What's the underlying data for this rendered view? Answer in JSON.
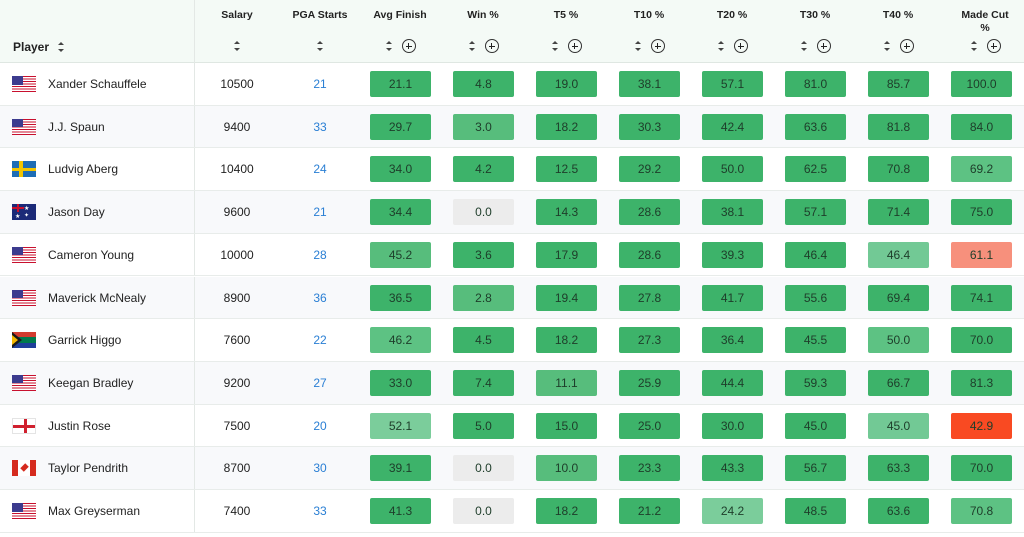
{
  "columns": {
    "player": "Player",
    "salary": "Salary",
    "pga_starts": "PGA Starts",
    "avg_finish": "Avg Finish",
    "win": "Win %",
    "t5": "T5 %",
    "t10": "T10 %",
    "t20": "T20 %",
    "t30": "T30 %",
    "t40": "T40 %",
    "made_cut": "Made Cut\n%"
  },
  "rows": [
    {
      "name": "Xander Schauffele",
      "flag": "us-flag-icon",
      "salary": "10500",
      "starts": "21",
      "avg_finish": "21.1",
      "win": "4.8",
      "t5": "19.0",
      "t10": "38.1",
      "t20": "57.1",
      "t30": "81.0",
      "t40": "85.7",
      "made_cut": "100.0"
    },
    {
      "name": "J.J. Spaun",
      "flag": "us-flag-icon",
      "salary": "9400",
      "starts": "33",
      "avg_finish": "29.7",
      "win": "3.0",
      "t5": "18.2",
      "t10": "30.3",
      "t20": "42.4",
      "t30": "63.6",
      "t40": "81.8",
      "made_cut": "84.0"
    },
    {
      "name": "Ludvig Aberg",
      "flag": "sweden-flag-icon",
      "salary": "10400",
      "starts": "24",
      "avg_finish": "34.0",
      "win": "4.2",
      "t5": "12.5",
      "t10": "29.2",
      "t20": "50.0",
      "t30": "62.5",
      "t40": "70.8",
      "made_cut": "69.2"
    },
    {
      "name": "Jason Day",
      "flag": "australia-flag-icon",
      "salary": "9600",
      "starts": "21",
      "avg_finish": "34.4",
      "win": "0.0",
      "t5": "14.3",
      "t10": "28.6",
      "t20": "38.1",
      "t30": "57.1",
      "t40": "71.4",
      "made_cut": "75.0"
    },
    {
      "name": "Cameron Young",
      "flag": "us-flag-icon",
      "salary": "10000",
      "starts": "28",
      "avg_finish": "45.2",
      "win": "3.6",
      "t5": "17.9",
      "t10": "28.6",
      "t20": "39.3",
      "t30": "46.4",
      "t40": "46.4",
      "made_cut": "61.1"
    },
    {
      "name": "Maverick McNealy",
      "flag": "us-flag-icon",
      "salary": "8900",
      "starts": "36",
      "avg_finish": "36.5",
      "win": "2.8",
      "t5": "19.4",
      "t10": "27.8",
      "t20": "41.7",
      "t30": "55.6",
      "t40": "69.4",
      "made_cut": "74.1"
    },
    {
      "name": "Garrick Higgo",
      "flag": "south-africa-flag-icon",
      "salary": "7600",
      "starts": "22",
      "avg_finish": "46.2",
      "win": "4.5",
      "t5": "18.2",
      "t10": "27.3",
      "t20": "36.4",
      "t30": "45.5",
      "t40": "50.0",
      "made_cut": "70.0"
    },
    {
      "name": "Keegan Bradley",
      "flag": "us-flag-icon",
      "salary": "9200",
      "starts": "27",
      "avg_finish": "33.0",
      "win": "7.4",
      "t5": "11.1",
      "t10": "25.9",
      "t20": "44.4",
      "t30": "59.3",
      "t40": "66.7",
      "made_cut": "81.3"
    },
    {
      "name": "Justin Rose",
      "flag": "england-flag-icon",
      "salary": "7500",
      "starts": "20",
      "avg_finish": "52.1",
      "win": "5.0",
      "t5": "15.0",
      "t10": "25.0",
      "t20": "30.0",
      "t30": "45.0",
      "t40": "45.0",
      "made_cut": "42.9"
    },
    {
      "name": "Taylor Pendrith",
      "flag": "canada-flag-icon",
      "salary": "8700",
      "starts": "30",
      "avg_finish": "39.1",
      "win": "0.0",
      "t5": "10.0",
      "t10": "23.3",
      "t20": "43.3",
      "t30": "56.7",
      "t40": "63.3",
      "made_cut": "70.0"
    },
    {
      "name": "Max Greyserman",
      "flag": "us-flag-icon",
      "salary": "7400",
      "starts": "33",
      "avg_finish": "41.3",
      "win": "0.0",
      "t5": "18.2",
      "t10": "21.2",
      "t20": "24.2",
      "t30": "48.5",
      "t40": "63.6",
      "made_cut": "70.8"
    }
  ],
  "cell_colors": [
    {
      "avg_finish": "#3db36a",
      "win": "#3db36a",
      "t5": "#3db36a",
      "t10": "#3db36a",
      "t20": "#3db36a",
      "t30": "#3db36a",
      "t40": "#3db36a",
      "made_cut": "#3db36a"
    },
    {
      "avg_finish": "#3db36a",
      "win": "#57bd7c",
      "t5": "#3db36a",
      "t10": "#3db36a",
      "t20": "#3db36a",
      "t30": "#3db36a",
      "t40": "#3db36a",
      "made_cut": "#3db36a"
    },
    {
      "avg_finish": "#3db36a",
      "win": "#3db36a",
      "t5": "#3db36a",
      "t10": "#3db36a",
      "t20": "#3db36a",
      "t30": "#3db36a",
      "t40": "#3db36a",
      "made_cut": "#5dc283"
    },
    {
      "avg_finish": "#3db36a",
      "win": "#ececec",
      "t5": "#3db36a",
      "t10": "#3db36a",
      "t20": "#3db36a",
      "t30": "#3db36a",
      "t40": "#3db36a",
      "made_cut": "#3db36a"
    },
    {
      "avg_finish": "#57bd7c",
      "win": "#3db36a",
      "t5": "#3db36a",
      "t10": "#3db36a",
      "t20": "#3db36a",
      "t30": "#3db36a",
      "t40": "#72c995",
      "made_cut": "#f7907c"
    },
    {
      "avg_finish": "#3db36a",
      "win": "#57bd7c",
      "t5": "#3db36a",
      "t10": "#3db36a",
      "t20": "#3db36a",
      "t30": "#3db36a",
      "t40": "#3db36a",
      "made_cut": "#3db36a"
    },
    {
      "avg_finish": "#5dc283",
      "win": "#3db36a",
      "t5": "#3db36a",
      "t10": "#3db36a",
      "t20": "#3db36a",
      "t30": "#3db36a",
      "t40": "#5dc283",
      "made_cut": "#3db36a"
    },
    {
      "avg_finish": "#3db36a",
      "win": "#3db36a",
      "t5": "#57bd7c",
      "t10": "#3db36a",
      "t20": "#3db36a",
      "t30": "#3db36a",
      "t40": "#3db36a",
      "made_cut": "#3db36a"
    },
    {
      "avg_finish": "#7bcd9b",
      "win": "#3db36a",
      "t5": "#3db36a",
      "t10": "#3db36a",
      "t20": "#3db36a",
      "t30": "#3db36a",
      "t40": "#72c995",
      "made_cut": "#f94a22"
    },
    {
      "avg_finish": "#3db36a",
      "win": "#ececec",
      "t5": "#57bd7c",
      "t10": "#3db36a",
      "t20": "#3db36a",
      "t30": "#3db36a",
      "t40": "#3db36a",
      "made_cut": "#3db36a"
    },
    {
      "avg_finish": "#3db36a",
      "win": "#ececec",
      "t5": "#3db36a",
      "t10": "#3db36a",
      "t20": "#7bcd9b",
      "t30": "#3db36a",
      "t40": "#3db36a",
      "made_cut": "#5dc283"
    }
  ]
}
